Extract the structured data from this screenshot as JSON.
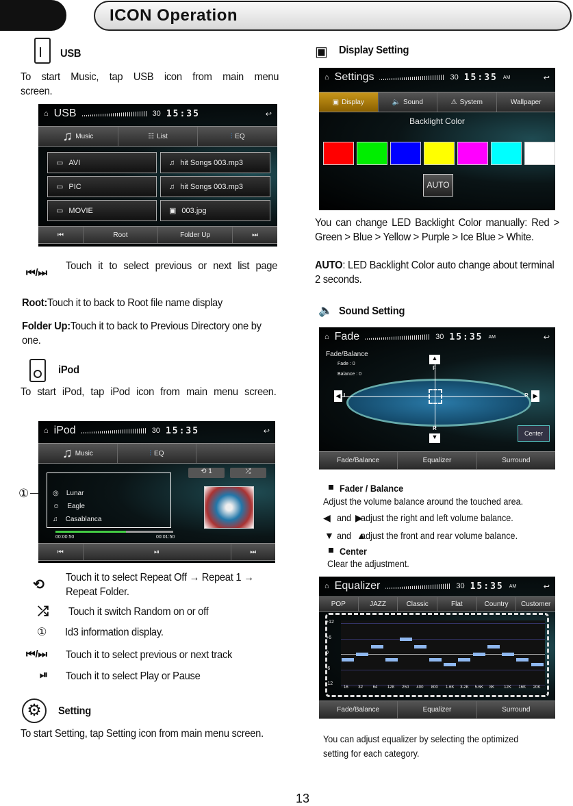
{
  "header": {
    "title": "ICON Operation"
  },
  "usb": {
    "heading": "USB",
    "desc": "To start  Music, tap  USB icon from main menu screen.",
    "screen": {
      "title": "USB",
      "volume": "30",
      "clock": "15:35",
      "tabs": [
        "Music",
        "List",
        "EQ"
      ],
      "folders": [
        "AVI",
        "PIC",
        "MOVIE"
      ],
      "files": [
        "hit Songs 003.mp3",
        "hit Songs 003.mp3",
        "003.jpg"
      ],
      "bottom": [
        "Root",
        "Folder Up"
      ]
    },
    "prev_next_desc": "Touch it to select previous or next list page",
    "root_label": "Root:",
    "root_desc": "Touch it to back to Root file name display",
    "folderup_label": "Folder Up:",
    "folderup_desc": "Touch it to back to Previous Directory one by one."
  },
  "ipod": {
    "heading": "iPod",
    "desc": "To start  iPod, tap  iPod icon from main menu screen.",
    "screen": {
      "title": "iPod",
      "volume": "30",
      "clock": "15:35",
      "tabs": [
        "Music",
        "EQ"
      ],
      "repeat": "1",
      "album": "Lunar",
      "artist": "Eagle",
      "song": "Casablanca",
      "elapsed": "00:00:50",
      "total": "00:01:50",
      "progress": 0.6
    },
    "callout": "①",
    "items": [
      {
        "icon": "repeat-icon",
        "text": "Touch it to select Repeat Off → Repeat 1 → Repeat Folder."
      },
      {
        "icon": "shuffle-icon",
        "text": "Touch it switch Random on or off"
      },
      {
        "icon": "①",
        "text": "Id3 information display."
      },
      {
        "icon": "prev-next-icon",
        "text": "Touch it to select previous or next track"
      },
      {
        "icon": "play-pause-icon",
        "text": "Touch it to select Play or Pause"
      }
    ]
  },
  "setting": {
    "heading": "Setting",
    "desc": "To start Setting, tap  Setting icon from main menu screen."
  },
  "display": {
    "heading": "Display Setting",
    "screen": {
      "title": "Settings",
      "volume": "30",
      "clock": "15:35",
      "ampm": "AM",
      "tabs": [
        "Display",
        "Sound",
        "System",
        "Wallpaper"
      ],
      "label": "Backlight Color",
      "colors": [
        "#ff0000",
        "#00ee00",
        "#0000ff",
        "#ffff00",
        "#ff00ff",
        "#00ffff",
        "#ffffff"
      ],
      "auto": "AUTO"
    },
    "desc1": "You can change LED Backlight Color manually: Red > Green > Blue > Yellow > Purple > Ice Blue > White.",
    "auto_label": "AUTO",
    "auto_desc": ":  LED Backlight Color auto change about terminal 2 seconds."
  },
  "sound": {
    "heading": "Sound Setting",
    "screen": {
      "title": "Fade",
      "volume": "30",
      "clock": "15:35",
      "ampm": "AM",
      "panel": "Fade/Balance",
      "fade": "Fade     : 0",
      "balance": "Balance : 0",
      "front": "F",
      "rear": "R",
      "left": "L",
      "right": "R",
      "center": "Center",
      "tabs": [
        "Fade/Balance",
        "Equalizer",
        "Surround"
      ]
    },
    "fb_heading": "Fader / Balance",
    "fb_desc": "Adjust the volume balance around the touched area.",
    "lr_desc": "and    adjust the right and left volume balance.",
    "fr_desc": "and    adjust the front and rear volume balance.",
    "center_heading": "Center",
    "center_desc": "Clear the adjustment."
  },
  "equalizer": {
    "screen": {
      "title": "Equalizer",
      "volume": "30",
      "clock": "15:35",
      "ampm": "AM",
      "presets": [
        "POP",
        "JAZZ",
        "Classic",
        "Flat",
        "Country",
        "Customer"
      ],
      "tabs": [
        "Fade/Balance",
        "Equalizer",
        "Surround"
      ]
    },
    "chart_data": {
      "type": "bar",
      "categories": [
        "16",
        "32",
        "64",
        "128",
        "250",
        "400",
        "800",
        "1.6K",
        "3.2K",
        "5.6K",
        "8K",
        "12K",
        "16K",
        "20K"
      ],
      "values": [
        -2,
        0,
        3,
        -2,
        6,
        3,
        -2,
        -4,
        -2,
        0,
        3,
        0,
        -2,
        -4
      ],
      "yticks": [
        "+12",
        "+6",
        "0",
        "-6",
        "-12"
      ],
      "ylim": [
        -12,
        12
      ]
    },
    "desc": "You can adjust equalizer by selecting the optimized setting for each category."
  },
  "page_number": "13"
}
